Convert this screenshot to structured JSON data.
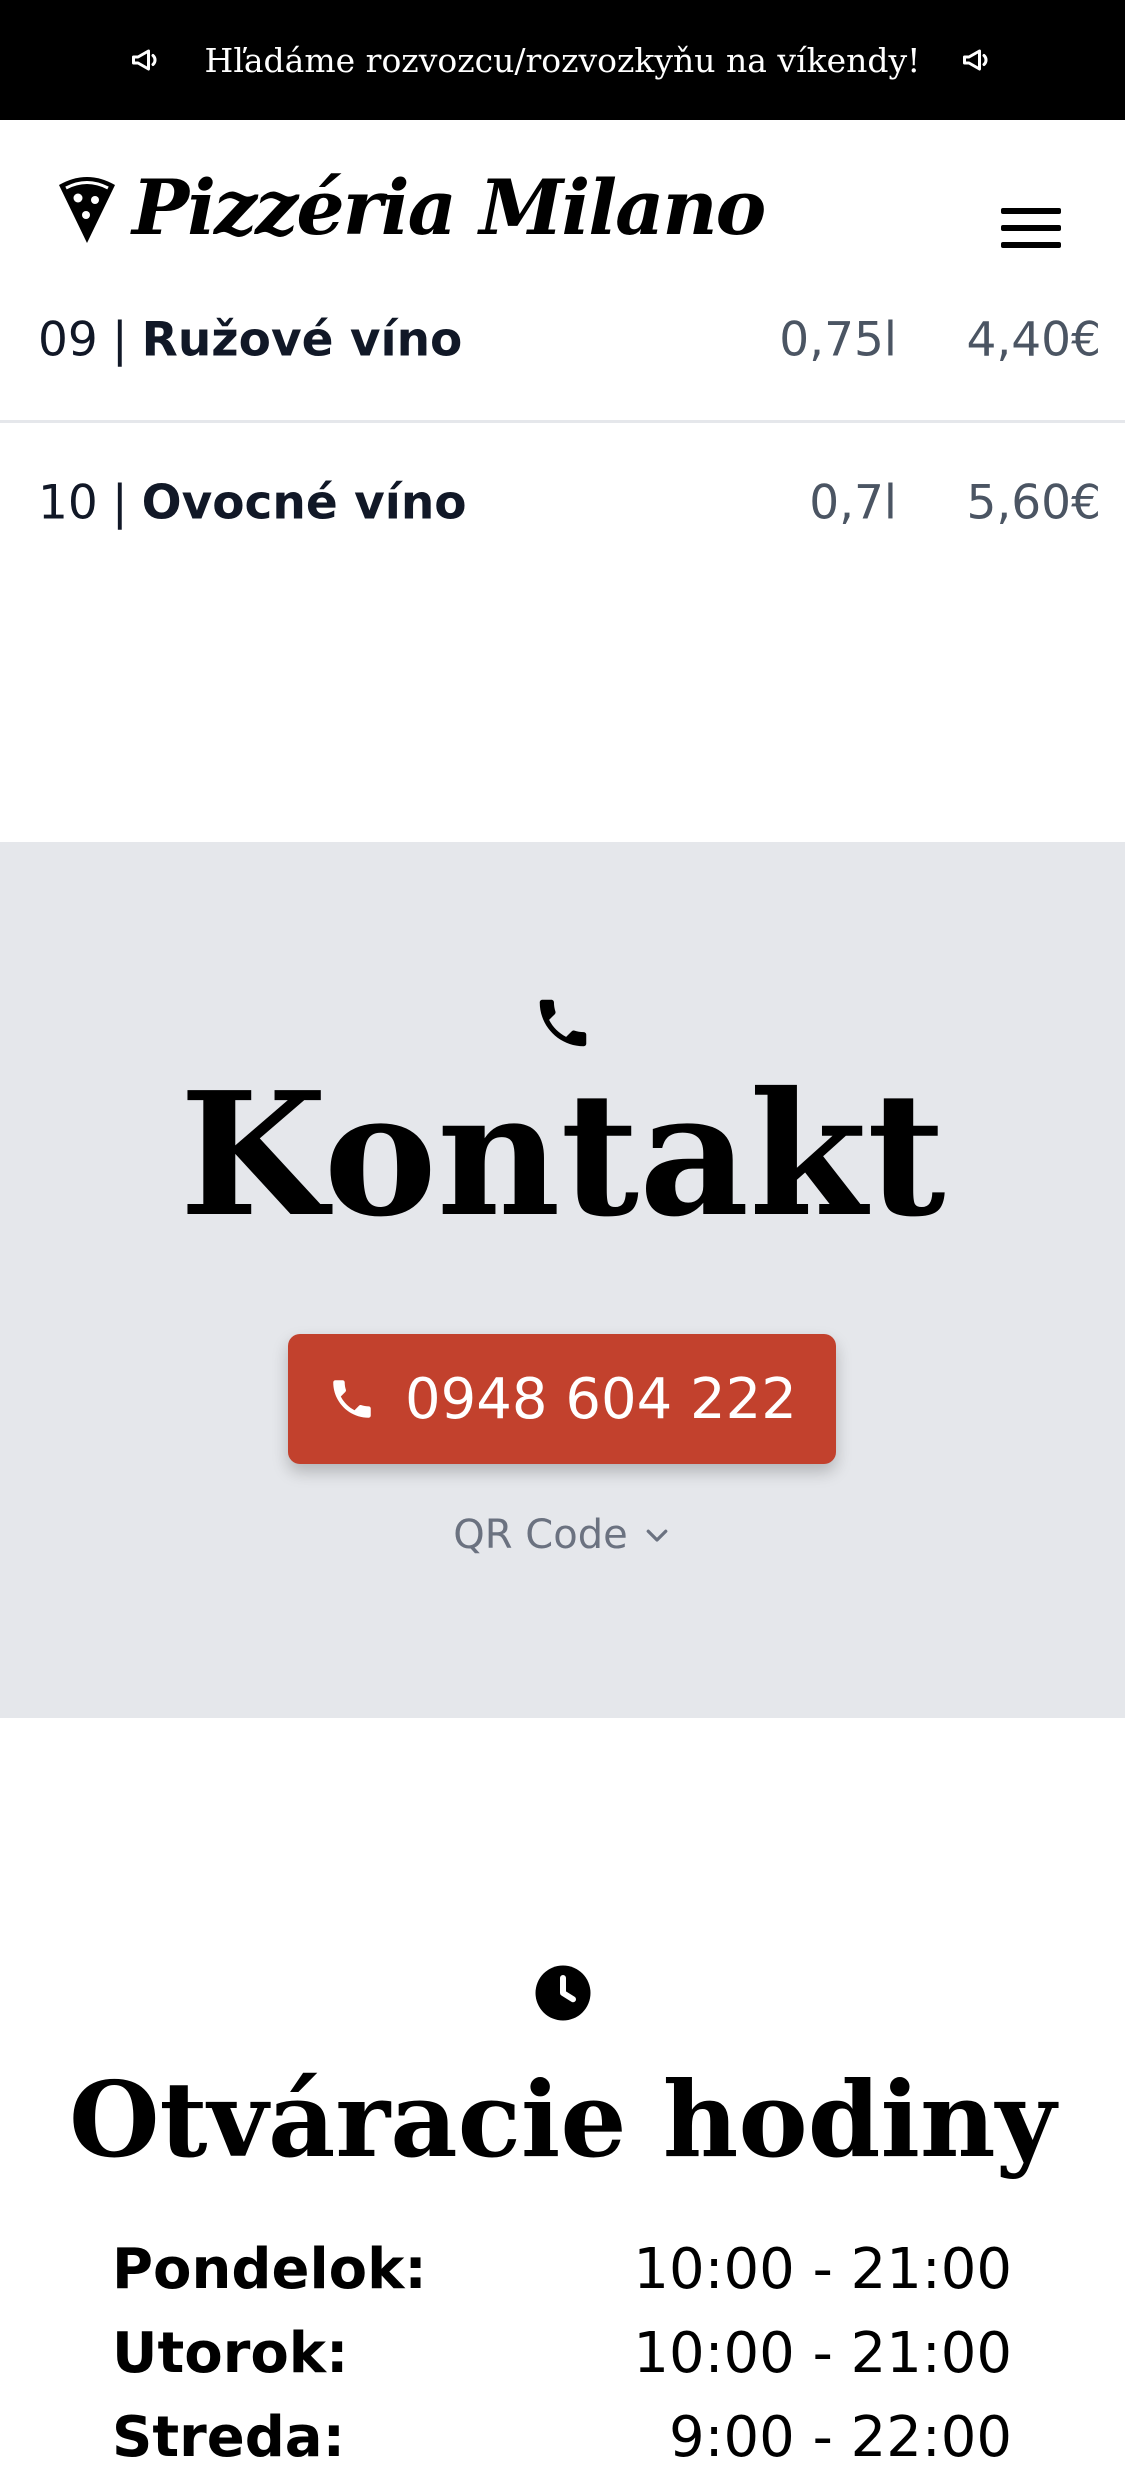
{
  "announcement": {
    "text": "Hľadáme rozvozcu/rozvozkyňu na víkendy!",
    "icon": "megaphone-icon"
  },
  "header": {
    "logo_text": "Pizzéria Milano",
    "logo_icon": "pizza-slice-icon",
    "menu_icon": "hamburger-menu-icon"
  },
  "menu": {
    "items": [
      {
        "number": "09",
        "name": "Ružové víno",
        "volume": "0,75l",
        "price": "4,40€"
      },
      {
        "number": "10",
        "name": "Ovocné víno",
        "volume": "0,7l",
        "price": "5,60€"
      }
    ]
  },
  "contact": {
    "title": "Kontakt",
    "icon": "phone-icon",
    "phone": "0948 604 222",
    "qr_label": "QR Code"
  },
  "hours": {
    "title": "Otváracie hodiny",
    "icon": "clock-icon",
    "rows": [
      {
        "day": "Pondelok:",
        "time": "10:00 - 21:00"
      },
      {
        "day": "Utorok:",
        "time": "10:00 - 21:00"
      },
      {
        "day": "Streda:",
        "time": "9:00 - 22:00"
      }
    ]
  },
  "colors": {
    "announcement_bg": "#000000",
    "contact_bg": "#e5e7eb",
    "accent": "#c2412d"
  }
}
